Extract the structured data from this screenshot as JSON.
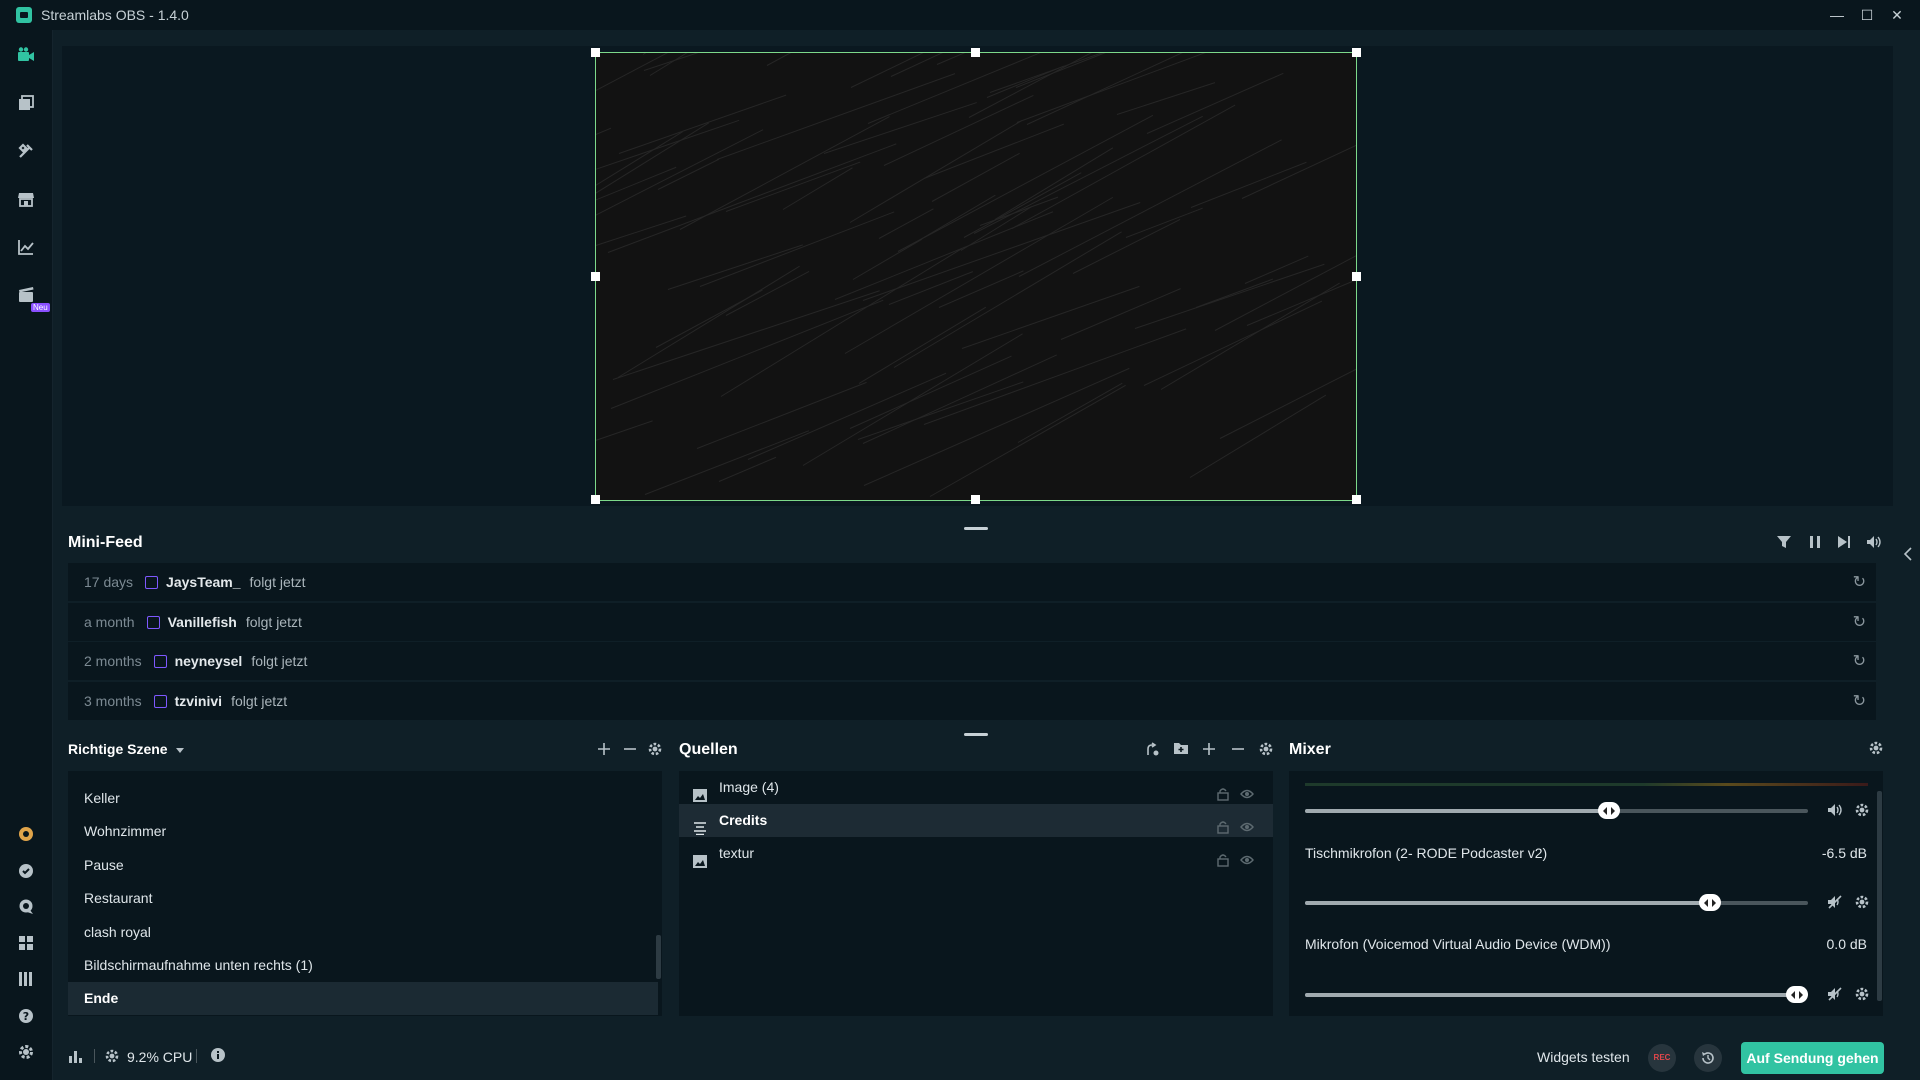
{
  "window": {
    "title": "Streamlabs OBS - 1.4.0",
    "controls": {
      "minimize": "—",
      "maximize": "☐",
      "close": "✕"
    }
  },
  "sidebar": {
    "items": [
      {
        "name": "editor-icon"
      },
      {
        "name": "themes-icon"
      },
      {
        "name": "app-store-icon"
      },
      {
        "name": "store-icon"
      },
      {
        "name": "dashboard-icon"
      },
      {
        "name": "highlighter-icon",
        "badge": "Neu"
      }
    ],
    "bottom": [
      {
        "name": "prime-icon"
      },
      {
        "name": "help-circle-icon"
      },
      {
        "name": "chat-icon"
      },
      {
        "name": "layout-icon"
      },
      {
        "name": "studio-mode-icon"
      },
      {
        "name": "question-icon"
      },
      {
        "name": "settings-icon"
      }
    ]
  },
  "minifeed": {
    "title": "Mini-Feed",
    "rows": [
      {
        "time": "17 days",
        "user": "JaysTeam_",
        "action": "folgt jetzt"
      },
      {
        "time": "a month",
        "user": "Vanillefish",
        "action": "folgt jetzt"
      },
      {
        "time": "2 months",
        "user": "neyneysel",
        "action": "folgt jetzt"
      },
      {
        "time": "3 months",
        "user": "tzvinivi",
        "action": "folgt jetzt"
      }
    ]
  },
  "scenes": {
    "title": "Richtige Szene",
    "items": [
      "Keller",
      "Wohnzimmer",
      "Pause",
      "Restaurant",
      "clash royal",
      "Bildschirmaufnahme unten rechts (1)",
      "Ende"
    ],
    "active": "Ende"
  },
  "sources": {
    "title": "Quellen",
    "items": [
      {
        "label": "Image (4)",
        "icon": "image-icon"
      },
      {
        "label": "Credits",
        "icon": "text-icon"
      },
      {
        "label": "textur",
        "icon": "image-icon"
      }
    ],
    "active": "Credits"
  },
  "mixer": {
    "title": "Mixer",
    "channels": [
      {
        "label": "",
        "db": "",
        "level": 0.61
      },
      {
        "label": "Tischmikrofon (2- RODE Podcaster v2)",
        "db": "-6.5 dB",
        "level": 0.82
      },
      {
        "label": "Mikrofon (Voicemod Virtual Audio Device (WDM))",
        "db": "0.0 dB",
        "level": 1.0
      }
    ]
  },
  "statusbar": {
    "cpu": "9.2% CPU",
    "widgets": "Widgets testen",
    "rec": "REC",
    "golive": "Auf Sendung gehen"
  },
  "colors": {
    "accent": "#31c3a2",
    "selection_border": "#7dd98a",
    "twitch": "#7e58ff"
  }
}
